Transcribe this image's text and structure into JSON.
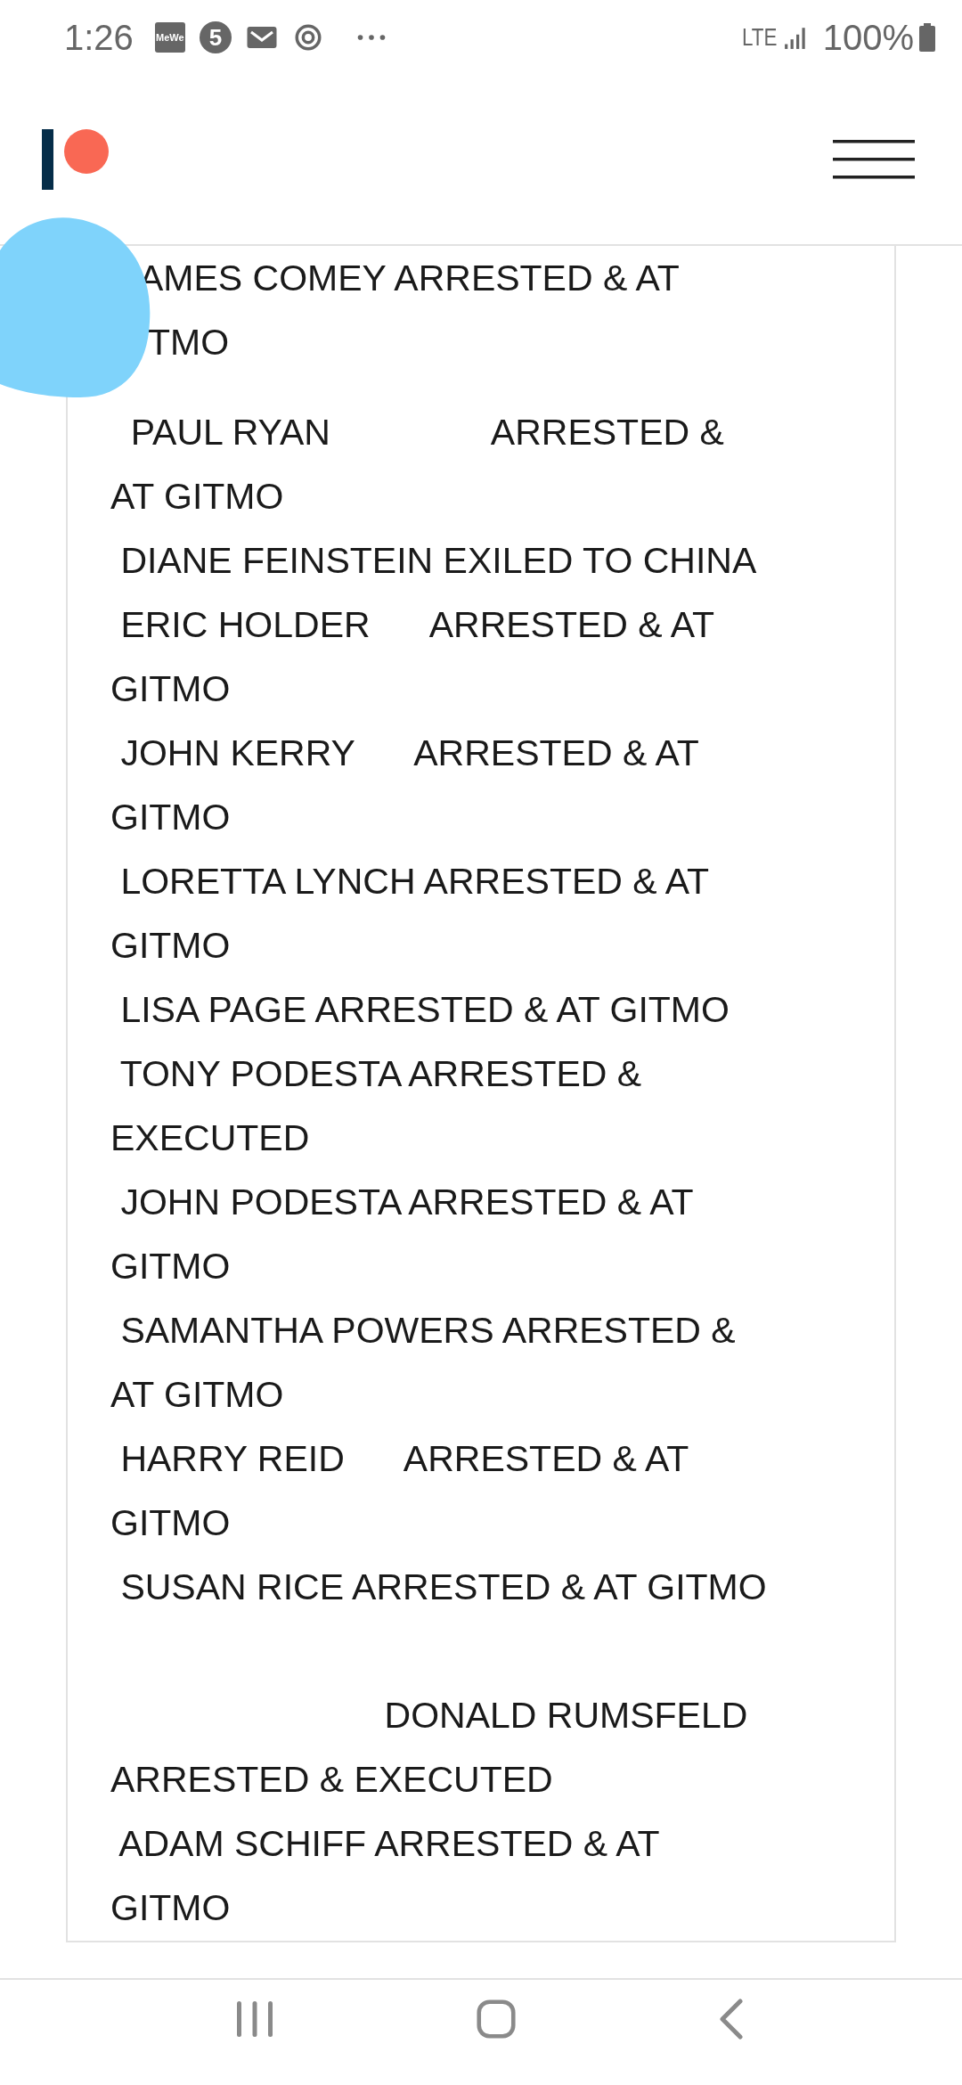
{
  "status_bar": {
    "time": "1:26",
    "app_badges": [
      "MeWe",
      "5"
    ],
    "network": "LTE",
    "battery": "100%"
  },
  "post": {
    "entries": [
      {
        "kind": "covered",
        "lines": [
          "AMES COMEY ARRESTED & AT",
          "TMO"
        ]
      },
      {
        "kind": "plain",
        "lines": [
          "  PAUL RYAN                ARRESTED &",
          "AT GITMO"
        ]
      },
      {
        "kind": "plain",
        "lines": [
          " DIANE FEINSTEIN EXILED TO CHINA"
        ]
      },
      {
        "kind": "plain",
        "lines": [
          " ERIC HOLDER      ARRESTED & AT",
          "GITMO"
        ]
      },
      {
        "kind": "plain",
        "lines": [
          " JOHN KERRY      ARRESTED & AT",
          "GITMO"
        ]
      },
      {
        "kind": "plain",
        "lines": [
          " LORETTA LYNCH ARRESTED & AT",
          "GITMO"
        ]
      },
      {
        "kind": "plain",
        "lines": [
          " LISA PAGE ARRESTED & AT GITMO"
        ]
      },
      {
        "kind": "plain",
        "lines": [
          " TONY PODESTA ARRESTED &",
          "EXECUTED"
        ]
      },
      {
        "kind": "plain",
        "lines": [
          " JOHN PODESTA ARRESTED & AT",
          "GITMO"
        ]
      },
      {
        "kind": "plain",
        "lines": [
          " SAMANTHA POWERS ARRESTED &",
          "AT GITMO"
        ]
      },
      {
        "kind": "plain",
        "lines": [
          " HARRY REID      ARRESTED & AT",
          "GITMO"
        ]
      },
      {
        "kind": "plain",
        "lines": [
          " SUSAN RICE ARRESTED & AT GITMO"
        ]
      },
      {
        "kind": "spaced",
        "lines": [
          "                           DONALD RUMSFELD",
          "ARRESTED & EXECUTED"
        ]
      },
      {
        "kind": "plain",
        "lines": [
          " ADAM SCHIFF ARRESTED & AT",
          "GITMO"
        ]
      }
    ]
  }
}
